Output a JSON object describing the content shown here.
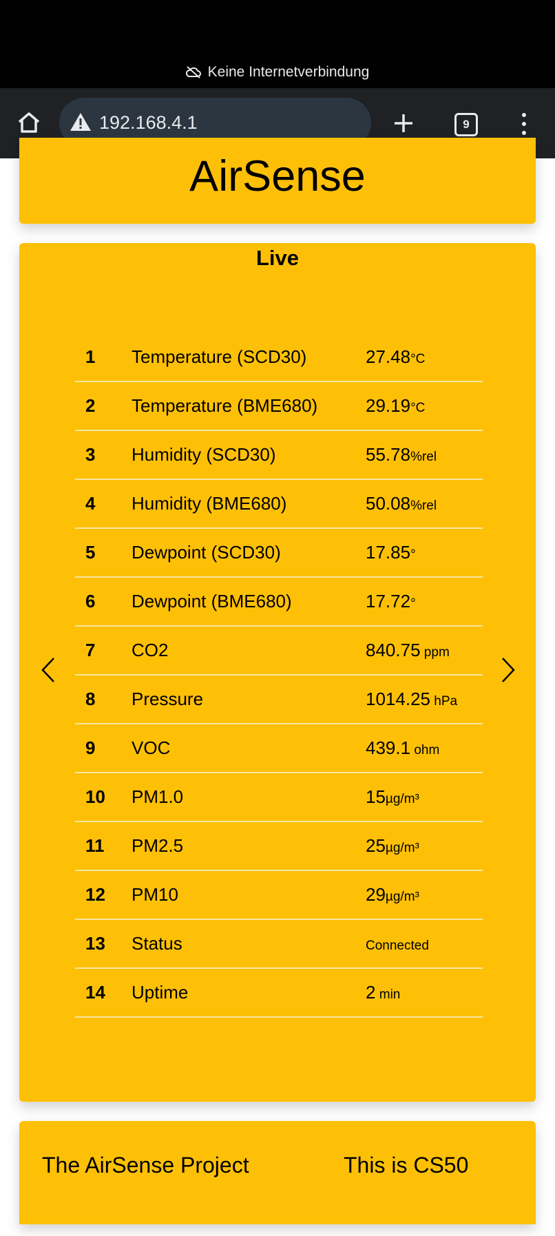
{
  "status_bar": {
    "network_message": "Keine Internetverbindung"
  },
  "browser": {
    "url": "192.168.4.1",
    "tab_count": "9"
  },
  "page": {
    "title": "AirSense",
    "section_title": "Live",
    "rows": [
      {
        "index": "1",
        "name": "Temperature (SCD30)",
        "value": "27.48",
        "unit": "°C"
      },
      {
        "index": "2",
        "name": "Temperature (BME680)",
        "value": "29.19",
        "unit": "°C"
      },
      {
        "index": "3",
        "name": "Humidity (SCD30)",
        "value": "55.78",
        "unit": "%rel"
      },
      {
        "index": "4",
        "name": "Humidity (BME680)",
        "value": "50.08",
        "unit": "%rel"
      },
      {
        "index": "5",
        "name": "Dewpoint (SCD30)",
        "value": "17.85",
        "unit": "°"
      },
      {
        "index": "6",
        "name": "Dewpoint (BME680)",
        "value": "17.72",
        "unit": "°"
      },
      {
        "index": "7",
        "name": "CO2",
        "value": "840.75",
        "unit": " ppm"
      },
      {
        "index": "8",
        "name": "Pressure",
        "value": "1014.25",
        "unit": " hPa"
      },
      {
        "index": "9",
        "name": "VOC",
        "value": "439.1",
        "unit": " ohm"
      },
      {
        "index": "10",
        "name": "PM1.0",
        "value": "15",
        "unit": "µg/m³"
      },
      {
        "index": "11",
        "name": "PM2.5",
        "value": "25",
        "unit": "µg/m³"
      },
      {
        "index": "12",
        "name": "PM10",
        "value": "29",
        "unit": "µg/m³"
      },
      {
        "index": "13",
        "name": "Status",
        "value": "Connected",
        "unit": ""
      },
      {
        "index": "14",
        "name": "Uptime",
        "value": "2",
        "unit": " min"
      }
    ],
    "footer": {
      "project_link": "The AirSense Project",
      "cs50_link": "This is CS50"
    }
  },
  "colors": {
    "card": "#fec006",
    "browser_bar": "#202124",
    "omnibox": "#2b3640"
  },
  "icons": [
    "cloud-off-icon",
    "home-icon",
    "warning-icon",
    "plus-icon",
    "tab-switcher-icon",
    "more-vert-icon",
    "chevron-left-icon",
    "chevron-right-icon"
  ]
}
